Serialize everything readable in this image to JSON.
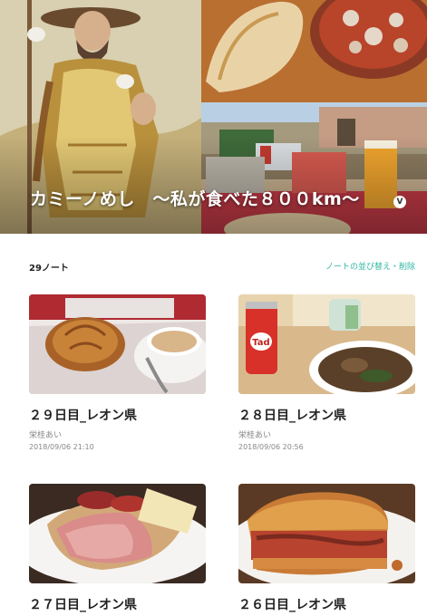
{
  "magazine": {
    "title": "カミーノめし　～私が食べた８００km～",
    "badge": "V"
  },
  "list": {
    "count": "29ノート",
    "sort_label": "ノートの並び替え・削除"
  },
  "notes": [
    {
      "title": "２９日目_レオン県",
      "author": "栄桂あい",
      "date": "2018/09/06 21:10"
    },
    {
      "title": "２８日目_レオン県",
      "author": "栄桂あい",
      "date": "2018/09/06 20:56"
    },
    {
      "title": "２７日目_レオン県"
    },
    {
      "title": "２６日目_レオン県"
    }
  ],
  "photo_labels": {
    "can_label": "Tad"
  }
}
